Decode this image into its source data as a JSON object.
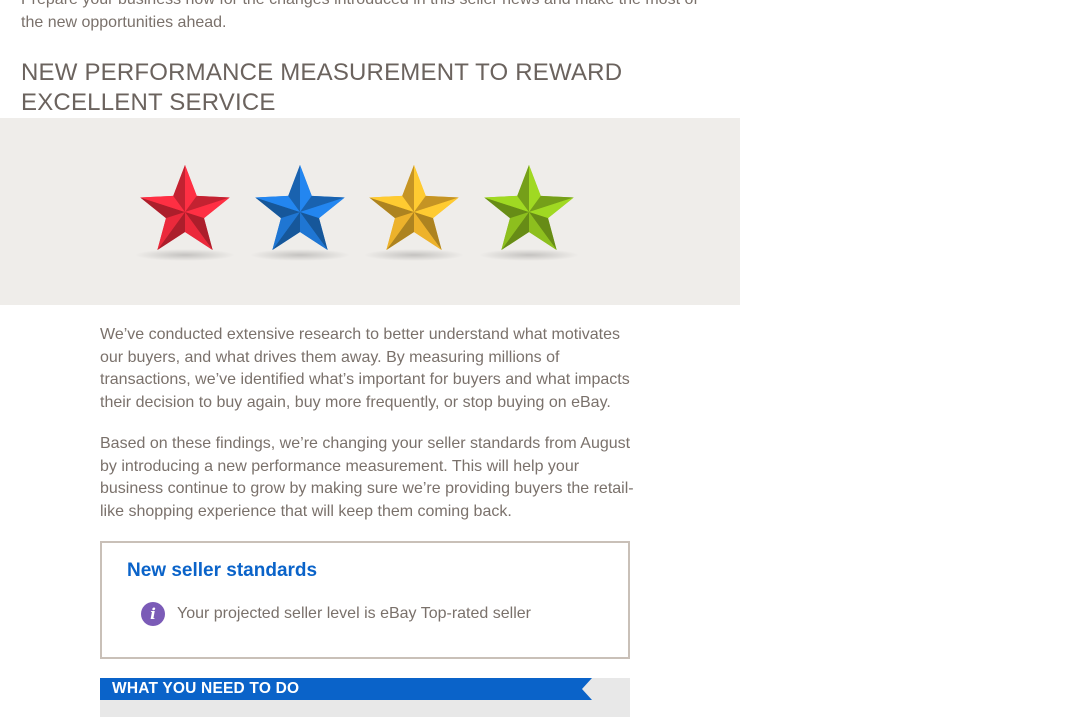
{
  "intro": {
    "text": "Prepare your business now for the changes introduced in this seller news and make the most of the new opportunities ahead."
  },
  "headline": "NEW PERFORMANCE MEASUREMENT TO REWARD EXCELLENT SERVICE",
  "banner": {
    "stars": [
      {
        "name": "red-star-icon",
        "color": "#ee2a3c"
      },
      {
        "name": "blue-star-icon",
        "color": "#1f78d6"
      },
      {
        "name": "yellow-star-icon",
        "color": "#f0b52c"
      },
      {
        "name": "green-star-icon",
        "color": "#8fc21e"
      }
    ]
  },
  "body": {
    "paragraph1": "We’ve conducted extensive research to better understand what motivates our buyers, and what drives them away. By measuring millions of transactions, we’ve identified what’s important for buyers and what impacts their decision to buy again, buy more frequently, or stop buying on eBay.",
    "paragraph2": "Based on these findings, we’re changing your seller standards from August by introducing a new performance measurement. This will help your business continue to grow by making sure we’re providing buyers the retail-like shopping experience that will keep them coming back."
  },
  "standards": {
    "title": "New seller standards",
    "info_icon": "info-icon",
    "info_text": "Your projected seller level is eBay Top-rated seller"
  },
  "todo": {
    "label": "WHAT YOU NEED TO DO",
    "color": "#0a63c9"
  }
}
